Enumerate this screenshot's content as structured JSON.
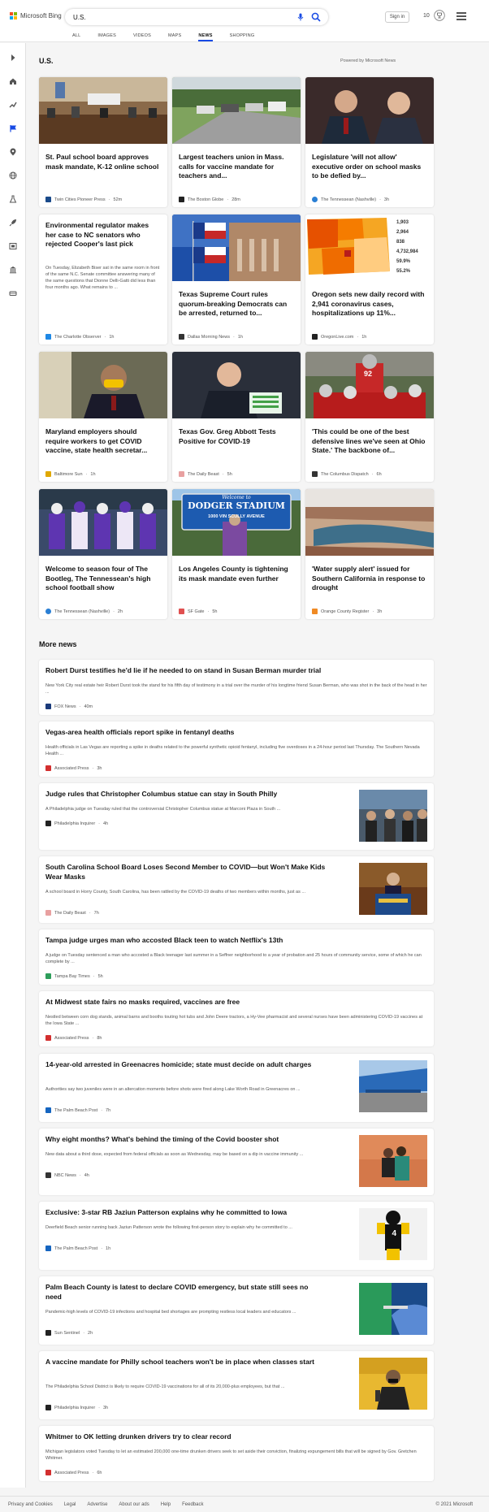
{
  "header": {
    "logo_text": "Microsoft Bing",
    "search_value": "U.S.",
    "signin_label": "Sign in",
    "points": "10",
    "scopes": [
      "ALL",
      "IMAGES",
      "VIDEOS",
      "MAPS",
      "NEWS",
      "SHOPPING"
    ],
    "active_scope": "NEWS"
  },
  "section": {
    "title": "U.S.",
    "powered_by": "Powered by Microsoft News"
  },
  "cards": [
    {
      "title": "St. Paul school board approves mask mandate, K-12 online school",
      "source": "Twin Cities Pioneer Press",
      "time": "52m",
      "favicon_color": "#1a4a8a"
    },
    {
      "title": "Largest teachers union in Mass. calls for vaccine mandate for teachers and...",
      "source": "The Boston Globe",
      "time": "28m",
      "favicon_color": "#222222"
    },
    {
      "title": "Legislature 'will not allow' executive order on school masks to be defied by...",
      "source": "The Tennessean (Nashville)",
      "time": "3h",
      "favicon_color": "#2a7fd4"
    },
    {
      "title": "Environmental regulator makes her case to NC senators who rejected Cooper's last pick",
      "snippet": "On Tuesday, Elizabeth Biser sat in the same room in front of the same N.C. Senate committee answering many of the same questions that Dionne Delli-Gatti did less than four months ago. What remains to ...",
      "source": "The Charlotte Observer",
      "time": "1h",
      "favicon_color": "#1e88e5"
    },
    {
      "title": "Texas Supreme Court rules quorum-breaking Democrats can be arrested, returned to...",
      "source": "Dallas Morning News",
      "time": "1h",
      "favicon_color": "#333333"
    },
    {
      "title": "Oregon sets new daily record with 2,941 coronavirus cases, hospitalizations up 11%...",
      "source": "OregonLive.com",
      "time": "1h",
      "favicon_color": "#222222"
    },
    {
      "title": "Maryland employers should require workers to get COVID vaccine, state health secretar...",
      "source": "Baltimore Sun",
      "time": "1h",
      "favicon_color": "#e0a800"
    },
    {
      "title": "Texas Gov. Greg Abbott Tests Positive for COVID-19",
      "source": "The Daily Beast",
      "time": "5h",
      "favicon_color": "#e8a0a0"
    },
    {
      "title": "'This could be one of the best defensive lines we've seen at Ohio State.' The backbone of...",
      "source": "The Columbus Dispatch",
      "time": "6h",
      "favicon_color": "#333333"
    },
    {
      "title": "Welcome to season four of The Bootleg, The Tennessean's high school football show",
      "source": "The Tennessean (Nashville)",
      "time": "2h",
      "favicon_color": "#2a7fd4"
    },
    {
      "title": "Los Angeles County is tightening its mask mandate even further",
      "source": "SF Gate",
      "time": "5h",
      "favicon_color": "#e05050"
    },
    {
      "title": "'Water supply alert' issued for Southern California in response to drought",
      "source": "Orange County Register",
      "time": "3h",
      "favicon_color": "#f08a24"
    }
  ],
  "oregon_stats": [
    "1,903",
    "2,964",
    "838",
    "4,732,984",
    "59.9%",
    "55.2%"
  ],
  "stadium_sign": {
    "top": "Welcome to",
    "main": "DODGER STADIUM",
    "bottom": "1000 VIN SCULLY AVENUE"
  },
  "jersey_number": "92",
  "more_news": {
    "title": "More news",
    "items": [
      {
        "title": "Robert Durst testifies he'd lie if he needed to on stand in Susan Berman murder trial",
        "snippet": "New York City real estate heir Robert Durst took the stand for his fifth day of testimony in a trial over the murder of his longtime friend Susan Berman, who was shot in the back of the head in her ...",
        "source": "FOX News",
        "time": "40m",
        "favicon_color": "#1a3a7a"
      },
      {
        "title": "Vegas-area health officials report spike in fentanyl deaths",
        "snippet": "Health officials in Las Vegas are reporting a spike in deaths related to the powerful synthetic opioid fentanyl, including five overdoses in a 24-hour period last Thursday. The Southern Nevada Health ...",
        "source": "Associated Press",
        "time": "3h",
        "favicon_color": "#d32f2f"
      },
      {
        "title": "Judge rules that Christopher Columbus statue can stay in South Philly",
        "snippet": "A Philadelphia judge on Tuesday ruled that the controversial Christopher Columbus statue at Marconi Plaza in South ...",
        "source": "Philadelphia Inquirer",
        "time": "4h",
        "favicon_color": "#222222"
      },
      {
        "title": "South Carolina School Board Loses Second Member to COVID—but Won't Make Kids Wear Masks",
        "snippet": "A school board in Horry County, South Carolina, has been rattled by the COVID-19 deaths of two members within months, just as ...",
        "source": "The Daily Beast",
        "time": "7h",
        "favicon_color": "#e8a0a0"
      },
      {
        "title": "Tampa judge urges man who accosted Black teen to watch Netflix's 13th",
        "snippet": "A judge on Tuesday sentenced a man who accosted a Black teenager last summer in a Seffner neighborhood to a year of probation and 25 hours of community service, some of which he can complete by ...",
        "source": "Tampa Bay Times",
        "time": "5h",
        "favicon_color": "#2e9e5b"
      },
      {
        "title": "At Midwest state fairs no masks required, vaccines are free",
        "snippet": "Nestled between corn dog stands, animal barns and booths touting hot tubs and John Deere tractors, a Hy-Vee pharmacist and several nurses have been administering COVID-19 vaccines at the Iowa State ...",
        "source": "Associated Press",
        "time": "8h",
        "favicon_color": "#d32f2f"
      },
      {
        "title": "14-year-old arrested in Greenacres homicide; state must decide on adult charges",
        "snippet": "Authorities say two juveniles were in an altercation moments before shots were fired along Lake Worth Road in Greenacres on ...",
        "source": "The Palm Beach Post",
        "time": "7h",
        "favicon_color": "#1565c0"
      },
      {
        "title": "Why eight months? What's behind the timing of the Covid booster shot",
        "snippet": "New data about a third dose, expected from federal officials as soon as Wednesday, may be based on a dip in vaccine immunity ...",
        "source": "NBC News",
        "time": "4h",
        "favicon_color": "#333333"
      },
      {
        "title": "Exclusive: 3-star RB Jaziun Patterson explains why he committed to Iowa",
        "snippet": "Deerfield Beach senior running back Jaziun Patterson wrote the following first-person story to explain why he committed to ...",
        "source": "The Palm Beach Post",
        "time": "1h",
        "favicon_color": "#1565c0"
      },
      {
        "title": "Palm Beach County is latest to declare COVID emergency, but state still sees no need",
        "snippet": "Pandemic-high levels of COVID-19 infections and hospital bed shortages are prompting restless local leaders and educators ...",
        "source": "Sun Sentinel",
        "time": "2h",
        "favicon_color": "#222222"
      },
      {
        "title": "A vaccine mandate for Philly school teachers won't be in place when classes start",
        "snippet": "The Philadelphia School District is likely to require COVID-19 vaccinations for all of its 20,000-plus employees, but that ...",
        "source": "Philadelphia Inquirer",
        "time": "3h",
        "favicon_color": "#222222"
      },
      {
        "title": "Whitmer to OK letting drunken drivers try to clear record",
        "snippet": "Michigan legislators voted Tuesday to let an estimated 200,000 one-time drunken drivers seek to set aside their conviction, finalizing expungement bills that will be signed by Gov. Gretchen Whitmer.",
        "source": "Associated Press",
        "time": "6h",
        "favicon_color": "#d32f2f"
      }
    ]
  },
  "thumb_jersey": "4",
  "footer": {
    "links": [
      "Privacy and Cookies",
      "Legal",
      "Advertise",
      "About our ads",
      "Help",
      "Feedback"
    ],
    "copyright": "© 2021 Microsoft"
  },
  "colors": {
    "accent": "#174ae4",
    "sidebar_active": "#174ae4"
  }
}
